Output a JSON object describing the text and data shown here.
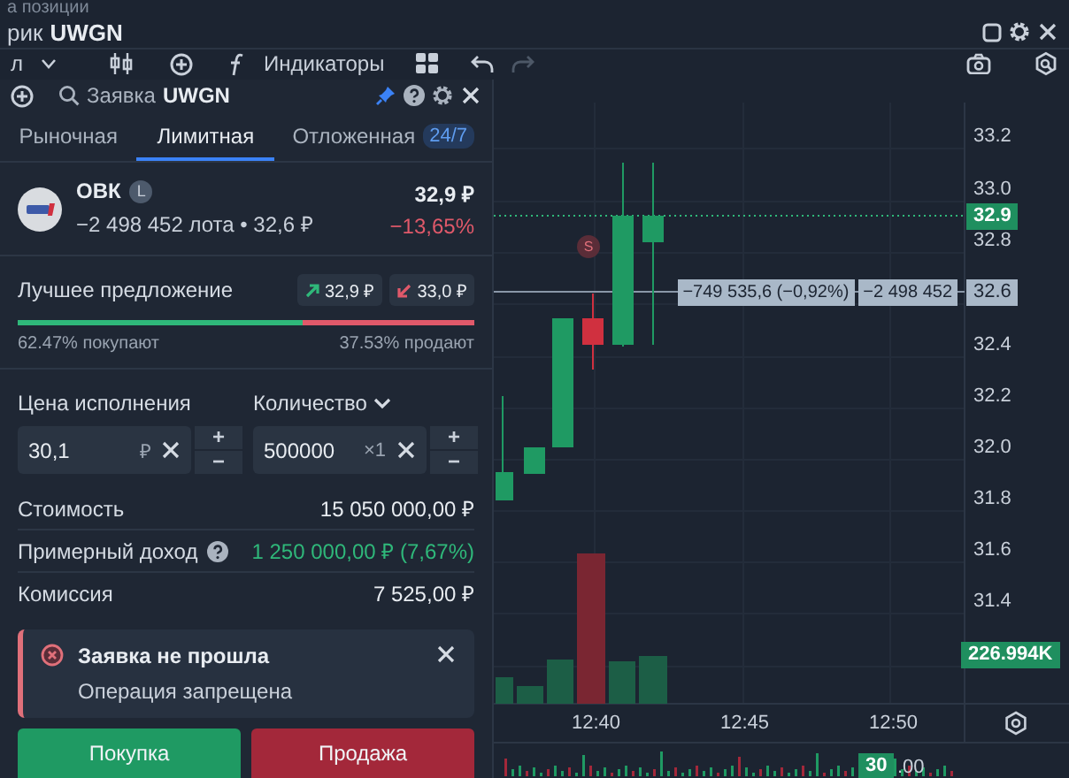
{
  "window": {
    "top_text": "а позиции",
    "title_prefix": "рик",
    "title": "UWGN"
  },
  "toolbar": {
    "interval": "л",
    "indicators": "Индикаторы"
  },
  "chart": {
    "axis": [
      {
        "kind": "tick",
        "label": "33.2"
      },
      {
        "kind": "tick",
        "label": "33.0"
      },
      {
        "kind": "last",
        "label": "32.9"
      },
      {
        "kind": "tick",
        "label": "32.8"
      },
      {
        "kind": "cross",
        "label": "32.6"
      },
      {
        "kind": "tick",
        "label": "32.4"
      },
      {
        "kind": "tick",
        "label": "32.2"
      },
      {
        "kind": "tick",
        "label": "32.0"
      },
      {
        "kind": "tick",
        "label": "31.8"
      },
      {
        "kind": "tick",
        "label": "31.6"
      },
      {
        "kind": "tick",
        "label": "31.4"
      },
      {
        "kind": "volume",
        "label": "226.994K"
      }
    ],
    "position_pnl": "−749 535,6 (−0,92%)",
    "position_qty": "−2 498 452",
    "marker": "S",
    "time_labels": [
      "12:40",
      "12:45",
      "12:50"
    ],
    "navigator": {
      "badge": "30",
      "text": ".00"
    }
  },
  "order_panel": {
    "title_prefix": "Заявка",
    "ticker": "UWGN",
    "tabs": [
      {
        "label": "Рыночная",
        "selected": false
      },
      {
        "label": "Лимитная",
        "selected": true
      },
      {
        "label": "Отложенная",
        "selected": false,
        "badge": "24/7"
      }
    ],
    "instrument": {
      "name": "ОВК",
      "badge": "L",
      "position": "−2 498 452 лота • 32,6 ₽",
      "price": "32,9 ₽",
      "change": "−13,65%"
    },
    "best_offer": {
      "label": "Лучшее предложение",
      "buy_price": "32,9 ₽",
      "sell_price": "33,0 ₽",
      "level": 0.6247,
      "buy_share": "62.47% покупают",
      "sell_share": "37.53% продают"
    },
    "price_field": {
      "label": "Цена исполнения",
      "value": "30,1",
      "unit": "₽",
      "stepper": [
        "+",
        "−"
      ]
    },
    "quantity_field": {
      "label": "Количество",
      "value": "500000",
      "unit": "×1",
      "stepper": [
        "+",
        "−"
      ]
    },
    "summary": [
      {
        "label": "Стоимость",
        "value": "15 050 000,00 ₽",
        "kind": "plain"
      },
      {
        "label": "Примерный доход",
        "value": "1 250 000,00 ₽ (7,67%)",
        "kind": "income"
      },
      {
        "label": "Комиссия",
        "value": "7 525,00 ₽",
        "kind": "plain"
      }
    ],
    "toast": {
      "title": "Заявка не прошла",
      "message": "Операция запрещена"
    },
    "buttons": [
      {
        "label": "Покупка",
        "kind": "buy"
      },
      {
        "label": "Продажа",
        "kind": "sell"
      }
    ]
  }
}
